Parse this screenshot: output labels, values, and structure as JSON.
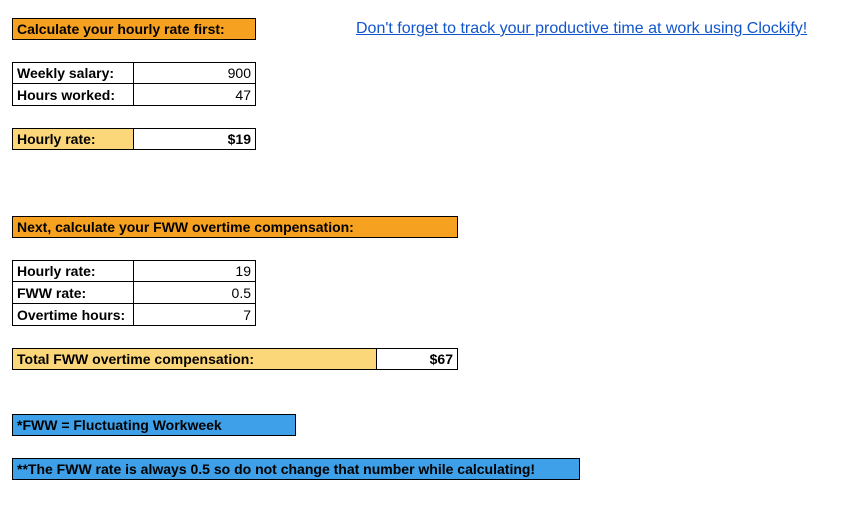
{
  "header": {
    "title": "Calculate your hourly rate first:",
    "link_text": "Don't forget to track your productive time at work using Clockify!"
  },
  "salary_table": {
    "rows": [
      {
        "label": "Weekly salary:",
        "value": "900"
      },
      {
        "label": "Hours worked:",
        "value": "47"
      }
    ]
  },
  "hourly_rate": {
    "label": "Hourly rate:",
    "value": "$19"
  },
  "section2_title": "Next, calculate your FWW overtime compensation:",
  "fww_table": {
    "rows": [
      {
        "label": "Hourly rate:",
        "value": "19"
      },
      {
        "label": "FWW rate:",
        "value": "0.5"
      },
      {
        "label": "Overtime hours:",
        "value": "7"
      }
    ]
  },
  "total": {
    "label": "Total FWW overtime compensation:",
    "value": "$67"
  },
  "note1": "*FWW = Fluctuating Workweek",
  "note2": "**The FWW rate is always 0.5 so do not change that number while calculating!"
}
